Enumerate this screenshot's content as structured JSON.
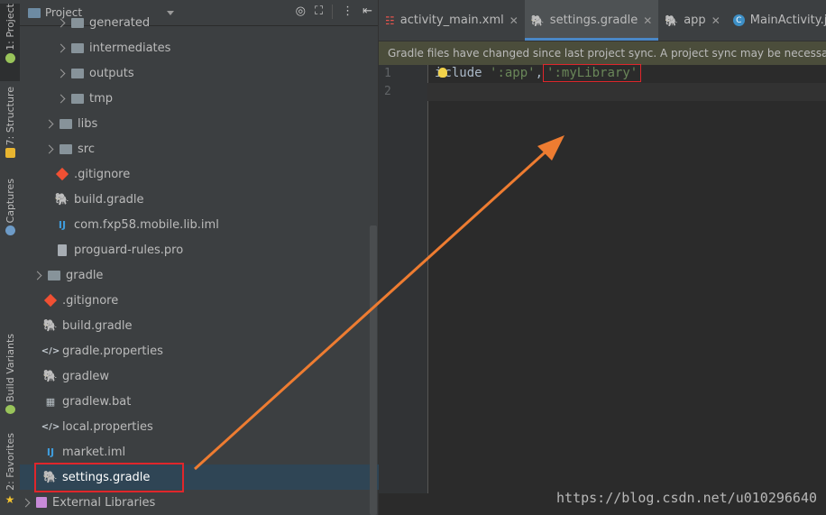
{
  "sidebar": {
    "tabs": [
      {
        "label": "1: Project",
        "icon": "android-icon"
      },
      {
        "label": "7: Structure",
        "icon": "structure-icon"
      },
      {
        "label": "Captures",
        "icon": "capture-icon"
      },
      {
        "label": "Build Variants",
        "icon": "android-icon"
      },
      {
        "label": "2: Favorites",
        "icon": "star-icon"
      }
    ]
  },
  "project_panel": {
    "title": "Project",
    "tree": [
      {
        "label": "generated",
        "icon": "folder-icon",
        "expandable": true
      },
      {
        "label": "intermediates",
        "icon": "folder-icon",
        "expandable": true
      },
      {
        "label": "outputs",
        "icon": "folder-icon",
        "expandable": true
      },
      {
        "label": "tmp",
        "icon": "folder-icon",
        "expandable": true
      },
      {
        "label": "libs",
        "icon": "folder-icon",
        "expandable": true
      },
      {
        "label": "src",
        "icon": "folder-icon",
        "expandable": true
      },
      {
        "label": ".gitignore",
        "icon": "git-icon",
        "expandable": false
      },
      {
        "label": "build.gradle",
        "icon": "gradle-icon",
        "expandable": false
      },
      {
        "label": "com.fxp58.mobile.lib.iml",
        "icon": "iml-icon",
        "expandable": false
      },
      {
        "label": "proguard-rules.pro",
        "icon": "file-icon",
        "expandable": false
      },
      {
        "label": "gradle",
        "icon": "folder-icon",
        "expandable": true
      },
      {
        "label": ".gitignore",
        "icon": "git-icon",
        "expandable": false
      },
      {
        "label": "build.gradle",
        "icon": "gradle-icon",
        "expandable": false
      },
      {
        "label": "gradle.properties",
        "icon": "properties-icon",
        "expandable": false
      },
      {
        "label": "gradlew",
        "icon": "gradle-icon",
        "expandable": false
      },
      {
        "label": "gradlew.bat",
        "icon": "bat-icon",
        "expandable": false
      },
      {
        "label": "local.properties",
        "icon": "properties-icon",
        "expandable": false
      },
      {
        "label": "market.iml",
        "icon": "iml-icon",
        "expandable": false
      },
      {
        "label": "settings.gradle",
        "icon": "gradle-icon",
        "expandable": false,
        "selected": true
      },
      {
        "label": "External Libraries",
        "icon": "library-icon",
        "expandable": true
      }
    ]
  },
  "editor": {
    "tabs": [
      {
        "label": "activity_main.xml",
        "icon": "xml-icon"
      },
      {
        "label": "settings.gradle",
        "icon": "gradle-icon",
        "active": true
      },
      {
        "label": "app",
        "icon": "gradle-icon"
      },
      {
        "label": "MainActivity.java",
        "icon": "java-class-icon"
      }
    ],
    "banner": "Gradle files have changed since last project sync. A project sync may be necessary f",
    "line_numbers": [
      "1",
      "2"
    ],
    "code": {
      "keyword_start": "i",
      "keyword_rest": "clude ",
      "str1": "':app'",
      "comma": ",",
      "str2": "':myLibrary'"
    }
  },
  "watermark": "https://blog.csdn.net/u010296640",
  "colors": {
    "annotation": "#e0262b",
    "arrow": "#ee7c31",
    "accent": "#4a88c7"
  }
}
